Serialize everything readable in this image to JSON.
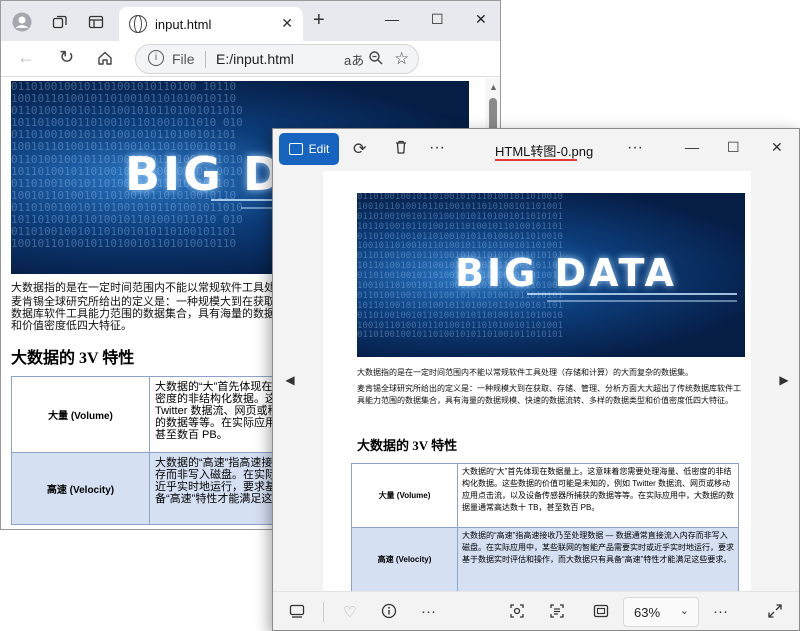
{
  "browser": {
    "tab_title": "input.html",
    "new_tab_label": "+",
    "url_prefix": "File",
    "url": "E:/input.html",
    "read_aloud": "aあ",
    "window_minimize": "—",
    "window_maximize": "☐",
    "window_close": "✕"
  },
  "page": {
    "image_text": "BIG DATA",
    "intro": "大数据指的是在一定时间范围内不能以常规软件工具处理（存储和计算）的大而复杂的数据集。",
    "definition": "麦肯锡全球研究所给出的定义是：一种规模大到在获取、存储、管理、分析方面大大超出了传统数据库软件工具能力范围的数据集合，具有海量的数据规模、快速的数据流转、多样的数据类型和价值密度低四大特征。",
    "heading": "大数据的 3V 特性",
    "rows": [
      {
        "key": "大量 (Volume)",
        "value": "大数据的“大”首先体现在数据量上。这意味着您需要处理海量、低密度的非结构化数据。这些数据的价值可能是未知的，例如 Twitter 数据流、网页或移动应用点击流，以及设备传感器所捕获的数据等等。在实际应用中，大数据的数据量通常高达数十 TB，甚至数百 PB。"
      },
      {
        "key": "高速 (Velocity)",
        "value": "大数据的“高速”指高速接收乃至处理数据 — 数据通常直接流入内存而非写入磁盘。在实际应用中，某些联网的智能产品需要实时或近乎实时地运行，要求基于数据实时评估和操作，而大数据只有具备“高速”特性才能满足这些要求。"
      }
    ]
  },
  "photos": {
    "edit_label": "Edit",
    "title": "HTML转图-0.png",
    "more_label": "···",
    "zoom": "63%",
    "prev_label": "◀",
    "next_label": "▶",
    "window_minimize": "—",
    "window_maximize": "☐",
    "window_close": "✕"
  },
  "colors": {
    "accent": "#1664c0",
    "title_underline": "#e53935",
    "table_alt_row": "#d5e0f3"
  }
}
